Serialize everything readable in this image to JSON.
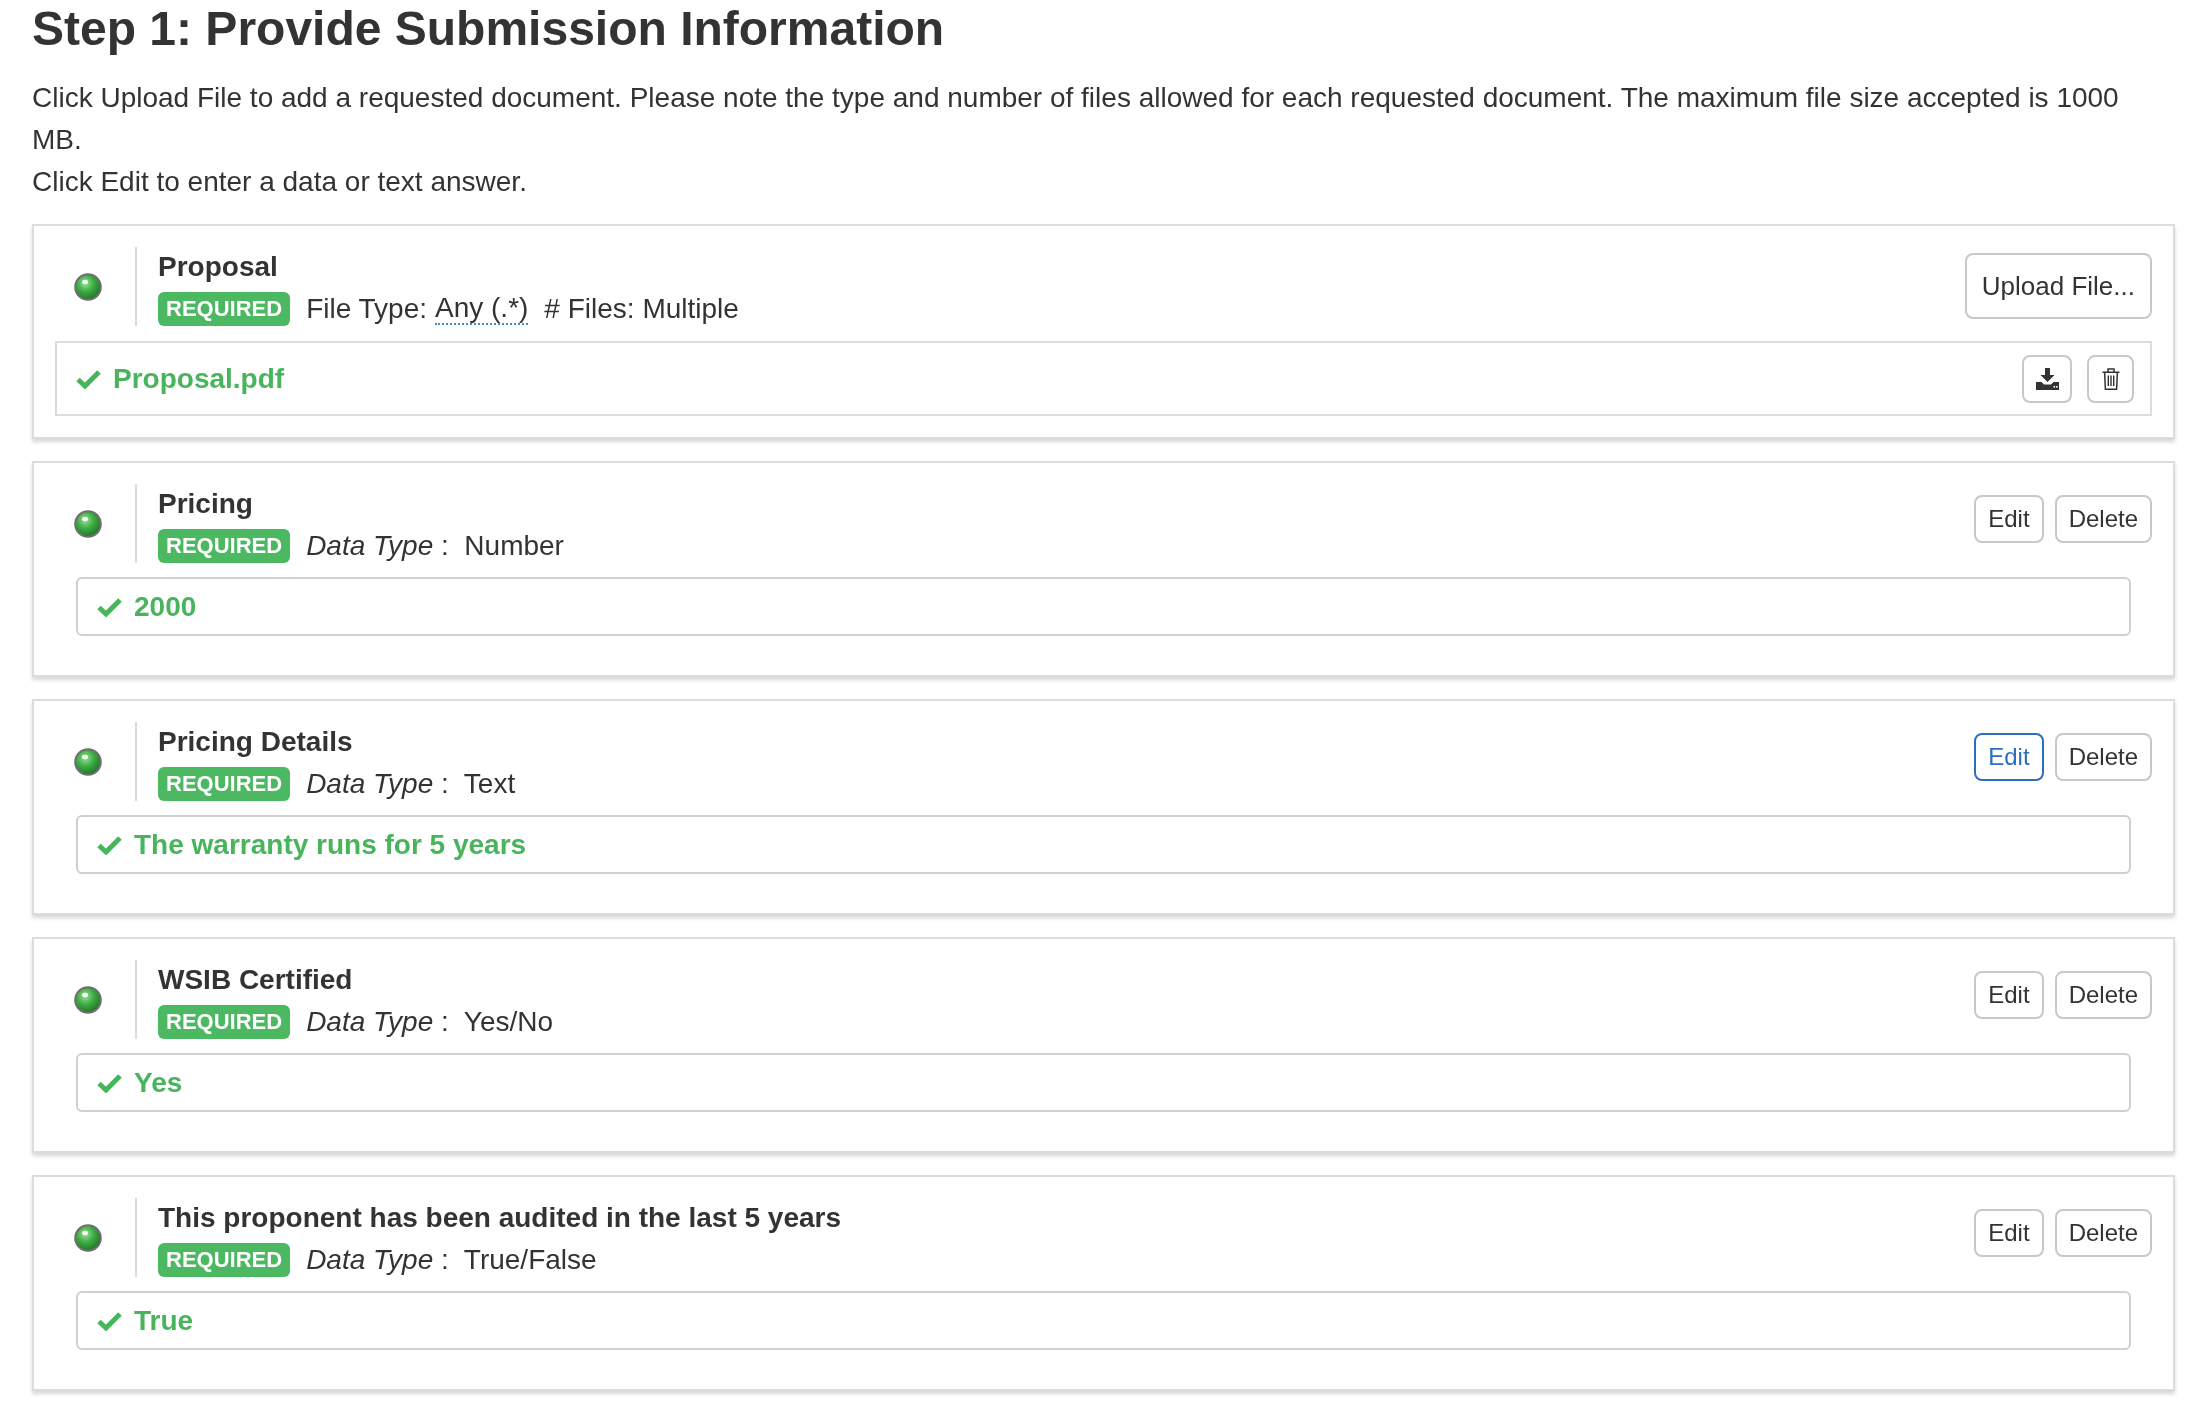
{
  "title": "Step 1: Provide Submission Information",
  "intro": [
    "Click Upload File to add a requested document. Please note the type and number of files allowed for each requested document. The maximum file size accepted is 1000 MB.",
    "Click Edit to enter a data or text answer."
  ],
  "cards": [
    {
      "kind": "file",
      "title": "Proposal",
      "badge": "REQUIRED",
      "file_type_label": "File Type:",
      "file_type": "Any (.*)",
      "file_count": "# Files: Multiple",
      "upload_button": "Upload File...",
      "file": {
        "name": "Proposal.pdf"
      }
    },
    {
      "kind": "answer",
      "title": "Pricing",
      "badge": "REQUIRED",
      "meta": "*Data Type* :  Number",
      "buttons": [
        {
          "label": "Edit",
          "focused": false
        },
        {
          "label": "Delete",
          "focused": false
        }
      ],
      "answer": "2000"
    },
    {
      "kind": "answer",
      "title": "Pricing Details",
      "badge": "REQUIRED",
      "meta": "*Data Type* :  Text",
      "buttons": [
        {
          "label": "Edit",
          "focused": true
        },
        {
          "label": "Delete",
          "focused": false
        }
      ],
      "answer": "The warranty runs for 5 years"
    },
    {
      "kind": "answer",
      "title": "WSIB Certified",
      "badge": "REQUIRED",
      "meta": "*Data Type* :  Yes/No",
      "buttons": [
        {
          "label": "Edit",
          "focused": false
        },
        {
          "label": "Delete",
          "focused": false
        }
      ],
      "answer": "Yes"
    },
    {
      "kind": "answer",
      "title": "This proponent has been audited in the last 5 years",
      "badge": "REQUIRED",
      "meta": "*Data Type* :  True/False",
      "buttons": [
        {
          "label": "Edit",
          "focused": false
        },
        {
          "label": "Delete",
          "focused": false
        }
      ],
      "answer": "True"
    }
  ]
}
